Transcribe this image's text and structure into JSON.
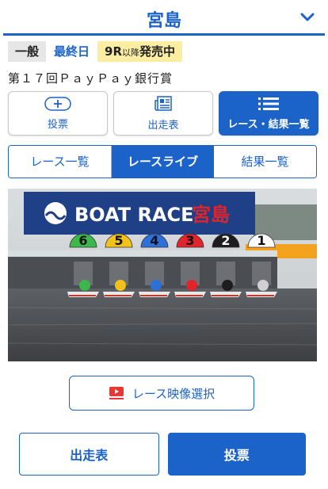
{
  "header": {
    "title": "宮島",
    "chevron_icon": "chevron-down-icon"
  },
  "badges": {
    "grade": "一般",
    "day": "最終日",
    "sale_race": "9R",
    "sale_small": "以降",
    "sale_text": "発売中"
  },
  "race_name": "第１７回ＰａｙＰａｙ銀行賞",
  "nav_cards": [
    {
      "label": "投票",
      "icon": "plus-circle-icon"
    },
    {
      "label": "出走表",
      "icon": "newspaper-icon"
    },
    {
      "label": "レース・結果一覧",
      "icon": "list-icon"
    }
  ],
  "tabs": [
    {
      "label": "レース一覧"
    },
    {
      "label": "レースライブ"
    },
    {
      "label": "結果一覧"
    }
  ],
  "video": {
    "banner_text": "BOAT RACE",
    "banner_venue": "宮島",
    "lane_numbers": [
      "6",
      "5",
      "4",
      "3",
      "2",
      "1"
    ],
    "lane_colors": [
      "#3cb84a",
      "#f2c21b",
      "#2e6fd8",
      "#e0242c",
      "#1d1d1d",
      "#ffffff"
    ],
    "lane_text_colors": [
      "#111111",
      "#111111",
      "#111111",
      "#111111",
      "#ffffff",
      "#111111"
    ]
  },
  "video_select": {
    "label": "レース映像選択",
    "icon": "video-play-icon"
  },
  "bottom": {
    "entry_label": "出走表",
    "vote_label": "投票"
  },
  "colors": {
    "accent": "#1b62c9",
    "sale_bg": "#fbeea2"
  }
}
